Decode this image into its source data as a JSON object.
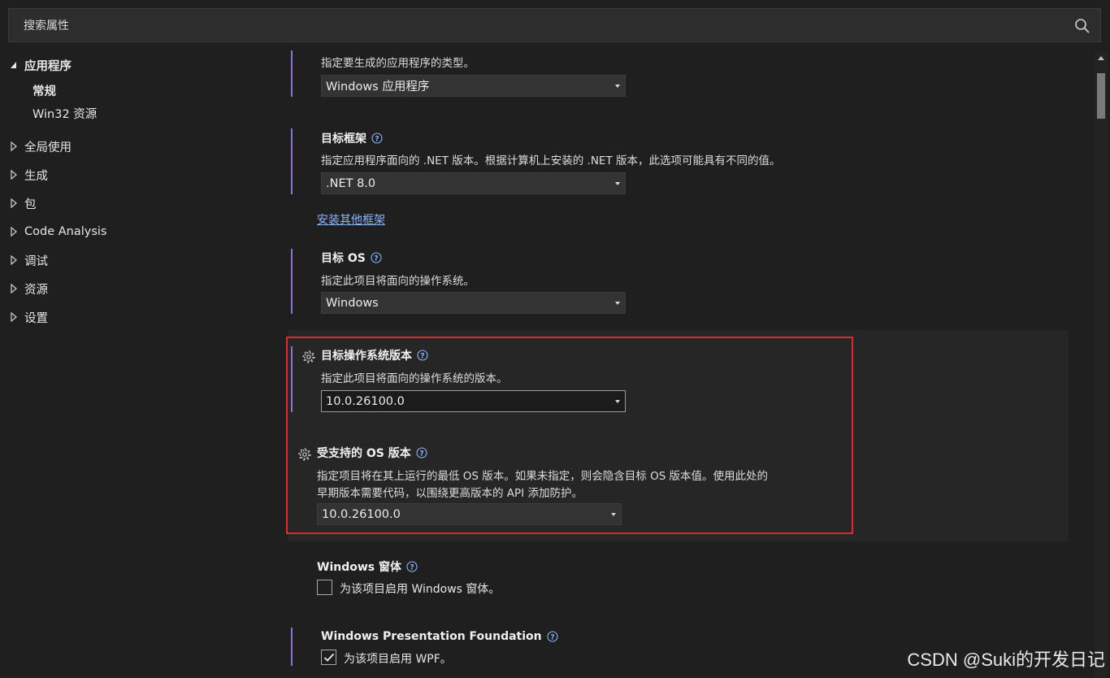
{
  "search": {
    "placeholder": "搜索属性"
  },
  "sidebar": {
    "items": [
      {
        "label": "应用程序",
        "expanded": true
      },
      {
        "label": "全局使用"
      },
      {
        "label": "生成"
      },
      {
        "label": "包"
      },
      {
        "label": "Code Analysis"
      },
      {
        "label": "调试"
      },
      {
        "label": "资源"
      },
      {
        "label": "设置"
      }
    ],
    "subitems": [
      {
        "label": "常规",
        "selected": true
      },
      {
        "label": "Win32 资源"
      }
    ]
  },
  "app_type": {
    "description": "指定要生成的应用程序的类型。",
    "value": "Windows 应用程序"
  },
  "target_framework": {
    "label": "目标框架",
    "description": "指定应用程序面向的 .NET 版本。根据计算机上安装的 .NET 版本，此选项可能具有不同的值。",
    "value": ".NET 8.0",
    "install_link": "安装其他框架"
  },
  "target_os": {
    "label": "目标 OS",
    "description": "指定此项目将面向的操作系统。",
    "value": "Windows"
  },
  "target_os_version": {
    "label": "目标操作系统版本",
    "description": "指定此项目将面向的操作系统的版本。",
    "value": "10.0.26100.0"
  },
  "supported_os_version": {
    "label": "受支持的 OS 版本",
    "description_line1": "指定项目将在其上运行的最低 OS 版本。如果未指定，则会隐含目标 OS 版本值。使用此处的",
    "description_line2": "早期版本需要代码，以围绕更高版本的 API 添加防护。",
    "value": "10.0.26100.0"
  },
  "windows_forms": {
    "label": "Windows 窗体",
    "checkbox_label": "为该项目启用 Windows 窗体。",
    "checked": false
  },
  "wpf": {
    "label": "Windows Presentation Foundation",
    "checkbox_label": "为该项目启用 WPF。",
    "checked": true
  },
  "watermark": "CSDN @Suki的开发日记",
  "colors": {
    "accent_bar": "#8a72d6",
    "highlight_border": "#e8242c",
    "link": "#8ab6ff"
  }
}
